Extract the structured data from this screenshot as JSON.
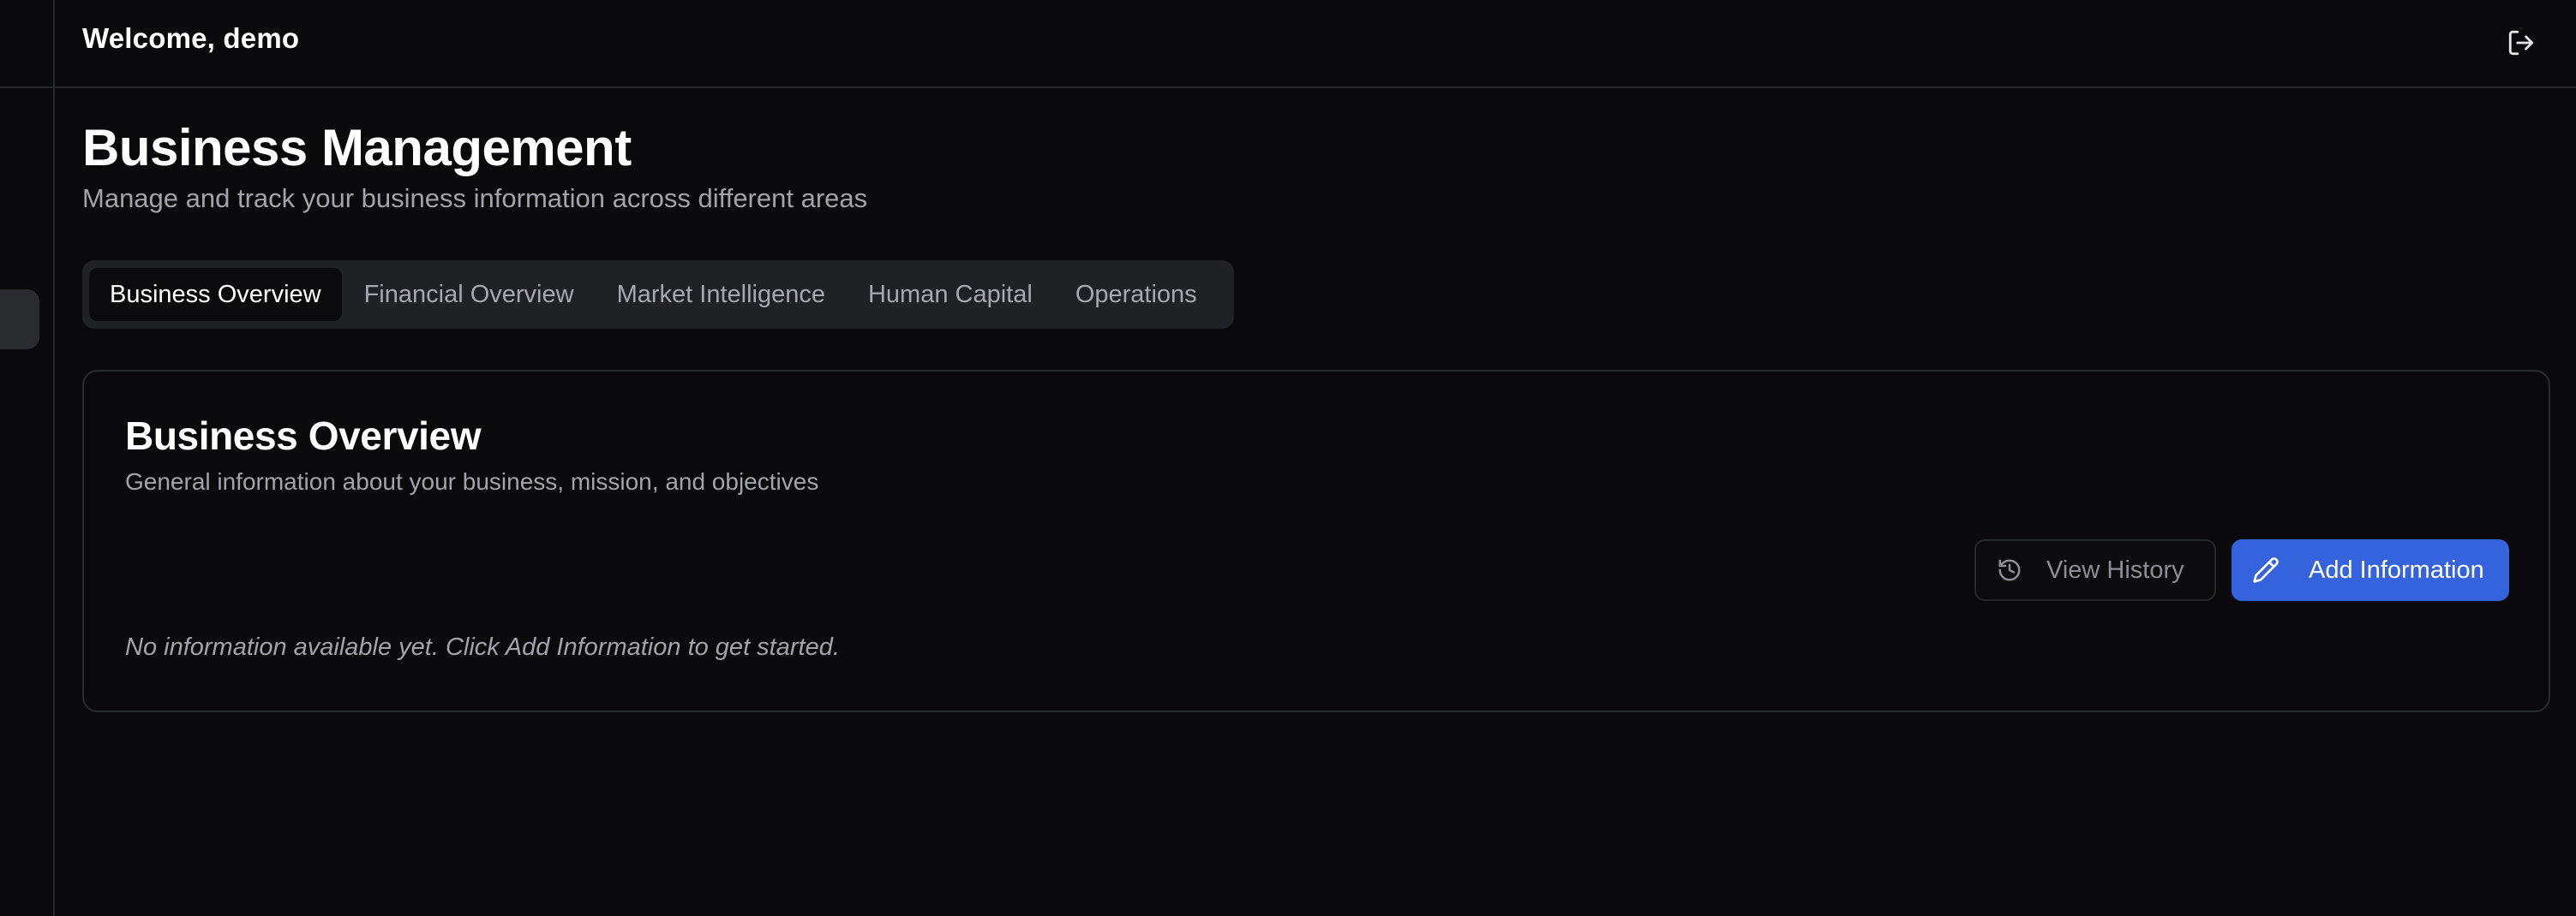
{
  "header": {
    "welcome_text": "Welcome, demo",
    "logout_icon": "logout-icon"
  },
  "page": {
    "title": "Business Management",
    "subtitle": "Manage and track your business information across different areas"
  },
  "tabs": [
    {
      "label": "Business Overview",
      "active": true
    },
    {
      "label": "Financial Overview",
      "active": false
    },
    {
      "label": "Market Intelligence",
      "active": false
    },
    {
      "label": "Human Capital",
      "active": false
    },
    {
      "label": "Operations",
      "active": false
    }
  ],
  "card": {
    "title": "Business Overview",
    "description": "General information about your business, mission, and objectives",
    "view_history_label": "View History",
    "view_history_icon": "history-icon",
    "add_information_label": "Add Information",
    "add_information_icon": "pencil-icon",
    "empty_message": "No information available yet. Click Add Information to get started."
  },
  "colors": {
    "background": "#0a0a0c",
    "accent": "#3563dd",
    "muted_text": "#a3a3aa",
    "border": "#26272b"
  }
}
